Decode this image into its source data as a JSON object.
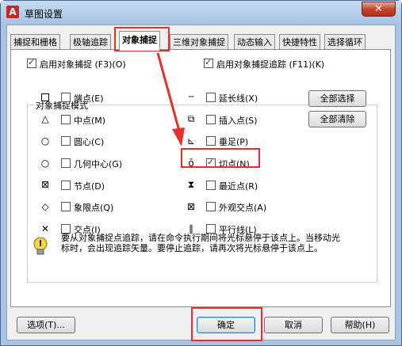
{
  "window": {
    "title": "草图设置",
    "close_glyph": "✕",
    "app_icon_glyph": "A"
  },
  "tabs": [
    {
      "label": "捕捉和栅格",
      "active": false
    },
    {
      "label": "极轴追踪",
      "active": false
    },
    {
      "label": "对象捕捉",
      "active": true
    },
    {
      "label": "三维对象捕捉",
      "active": false
    },
    {
      "label": "动态输入",
      "active": false
    },
    {
      "label": "快捷特性",
      "active": false
    },
    {
      "label": "选择循环",
      "active": false
    }
  ],
  "top_options": {
    "enable_osnap": {
      "label": "启用对象捕捉 (F3)(O)",
      "checked": true
    },
    "enable_tracking": {
      "label": "启用对象捕捉追踪 (F11)(K)",
      "checked": true
    }
  },
  "modes_group_title": "对象捕捉模式",
  "modes_left": [
    {
      "label": "端点(E)",
      "checked": false,
      "icon": "square-icon"
    },
    {
      "label": "中点(M)",
      "checked": false,
      "icon": "triangle-icon"
    },
    {
      "label": "圆心(C)",
      "checked": false,
      "icon": "circle-icon"
    },
    {
      "label": "几何中心(G)",
      "checked": false,
      "icon": "circle-icon"
    },
    {
      "label": "节点(D)",
      "checked": false,
      "icon": "node-icon"
    },
    {
      "label": "象限点(Q)",
      "checked": false,
      "icon": "diamond-icon"
    },
    {
      "label": "交点(I)",
      "checked": false,
      "icon": "cross-icon"
    }
  ],
  "modes_right": [
    {
      "label": "延长线(X)",
      "checked": false,
      "icon": "extension-icon"
    },
    {
      "label": "插入点(S)",
      "checked": false,
      "icon": "insert-icon"
    },
    {
      "label": "垂足(P)",
      "checked": false,
      "icon": "perpendicular-icon"
    },
    {
      "label": "切点(N)",
      "checked": true,
      "icon": "tangent-icon"
    },
    {
      "label": "最近点(R)",
      "checked": false,
      "icon": "nearest-icon"
    },
    {
      "label": "外观交点(A)",
      "checked": false,
      "icon": "apparent-intersection-icon"
    },
    {
      "label": "平行线(L)",
      "checked": false,
      "icon": "parallel-icon"
    }
  ],
  "select_all_label": "全部选择",
  "clear_all_label": "全部清除",
  "hint": "要从对象捕捉点追踪，请在命令执行期间将光标悬停于该点上。当移动光标时，会出现追踪矢量。要停止追踪，请再次将光标悬停于该点上。",
  "footer": {
    "options_label": "选项(T)...",
    "ok_label": "确定",
    "cancel_label": "取消",
    "help_label": "帮助(H)"
  },
  "colors": {
    "highlight": "#e4312b",
    "arrow": "#e4312b"
  }
}
